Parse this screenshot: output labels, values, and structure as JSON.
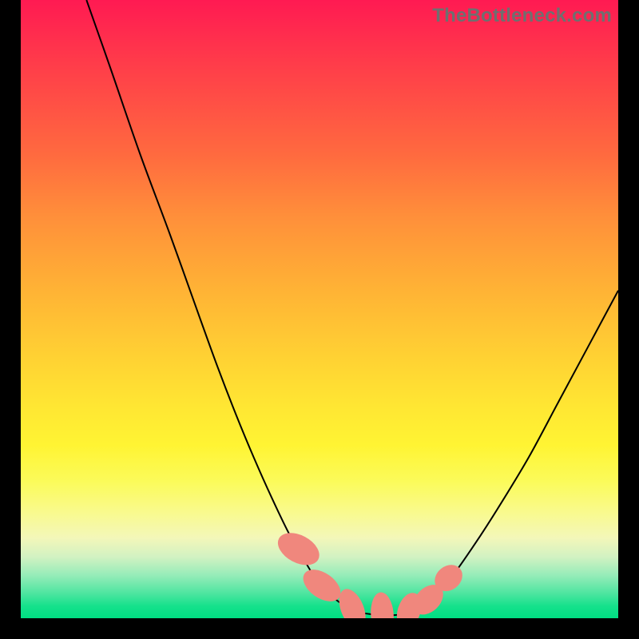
{
  "watermark": "TheBottleneck.com",
  "colors": {
    "curve_stroke": "#000000",
    "marker_fill": "#f0877d",
    "gradient_stops": [
      "#ff1a52",
      "#ff3b4a",
      "#ff6a3f",
      "#ff8f3a",
      "#ffb335",
      "#ffd233",
      "#ffe733",
      "#fff433",
      "#fbfb5b",
      "#f9fa8f",
      "#f3f7b9",
      "#d3f2c2",
      "#97ecb9",
      "#4de5a0",
      "#16e18c",
      "#00df82"
    ]
  },
  "chart_data": {
    "type": "line",
    "title": "",
    "xlabel": "",
    "ylabel": "",
    "xlim": [
      0,
      100
    ],
    "ylim": [
      0,
      100
    ],
    "grid": false,
    "series": [
      {
        "name": "left-branch",
        "x": [
          11,
          15,
          20,
          25,
          30,
          33,
          36,
          39,
          42,
          45,
          48,
          50,
          52.5,
          55,
          57.5
        ],
        "y": [
          100,
          89,
          75,
          62,
          48.5,
          40.5,
          33,
          26,
          19.5,
          13.5,
          8.5,
          5.5,
          3.2,
          1.6,
          0.8
        ]
      },
      {
        "name": "valley",
        "x": [
          57.5,
          60,
          62.5,
          65
        ],
        "y": [
          0.8,
          0.5,
          0.5,
          0.8
        ]
      },
      {
        "name": "right-branch",
        "x": [
          65,
          67,
          69,
          72,
          76,
          80,
          85,
          90,
          95,
          100
        ],
        "y": [
          0.8,
          1.8,
          3.2,
          6.5,
          12,
          18,
          26,
          35,
          44,
          53
        ]
      }
    ],
    "markers": [
      {
        "name": "marker-left-low",
        "cx": 46.5,
        "cy": 11.2,
        "rx": 2.3,
        "ry": 3.6,
        "rot": -62
      },
      {
        "name": "marker-left-lower",
        "cx": 50.4,
        "cy": 5.3,
        "rx": 2.1,
        "ry": 3.4,
        "rot": -55
      },
      {
        "name": "marker-valley-a",
        "cx": 55.5,
        "cy": 1.5,
        "rx": 1.9,
        "ry": 3.4,
        "rot": -22
      },
      {
        "name": "marker-valley-b",
        "cx": 60.5,
        "cy": 0.6,
        "rx": 1.9,
        "ry": 3.6,
        "rot": -4
      },
      {
        "name": "marker-valley-c",
        "cx": 65.0,
        "cy": 1.2,
        "rx": 1.9,
        "ry": 3.0,
        "rot": 18
      },
      {
        "name": "marker-right-low",
        "cx": 68.2,
        "cy": 3.0,
        "rx": 2.0,
        "ry": 2.8,
        "rot": 45
      },
      {
        "name": "marker-right-up",
        "cx": 71.6,
        "cy": 6.5,
        "rx": 2.0,
        "ry": 2.4,
        "rot": 52
      }
    ]
  }
}
